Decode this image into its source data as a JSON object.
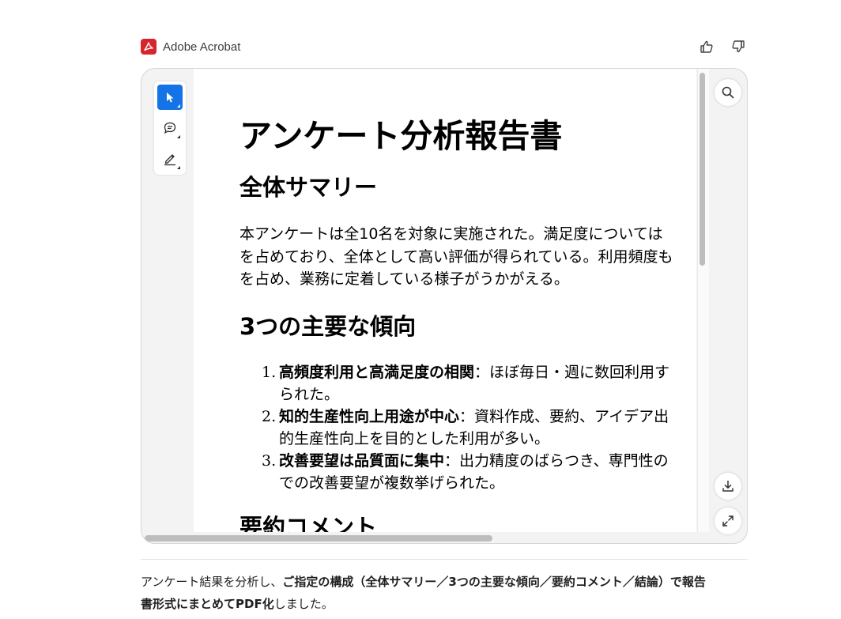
{
  "header": {
    "app_name": "Adobe Acrobat",
    "thumbs_up_icon": "thumbs-up-icon",
    "thumbs_down_icon": "thumbs-down-icon"
  },
  "toolbar": {
    "tools": [
      "select-pointer-icon",
      "comment-icon",
      "draw-pen-icon"
    ]
  },
  "document": {
    "title": "アンケート分析報告書",
    "sections": [
      {
        "heading": "全体サマリー",
        "paragraph_lines": [
          "本アンケートは全10名を対象に実施された。満足度については",
          "を占めており、全体として高い評価が得られている。利用頻度も",
          "を占め、業務に定着している様子がうかがえる。"
        ]
      },
      {
        "heading": "3つの主要な傾向",
        "items": [
          {
            "number": "1.",
            "bold": "高頻度利用と高満足度の相関",
            "rest": "：ほぼ毎日・週に数回利用す",
            "continuation": "られた。"
          },
          {
            "number": "2.",
            "bold": "知的生産性向上用途が中心",
            "rest": "：資料作成、要約、アイデア出",
            "continuation": "的生産性向上を目的とした利用が多い。"
          },
          {
            "number": "3.",
            "bold": "改善要望は品質面に集中",
            "rest": "：出力精度のばらつき、専門性の",
            "continuation": "での改善要望が複数挙げられた。"
          }
        ]
      },
      {
        "heading": "要約コメント"
      }
    ]
  },
  "side_buttons": {
    "search": "search-icon",
    "download": "download-icon",
    "expand": "expand-icon"
  },
  "summary": {
    "line1_plain": "アンケート結果を分析し、",
    "line1_bold": "ご指定の構成（全体サマリー／3つの主要な傾向／要約コメント／結論）で報告",
    "line2_bold": "書形式にまとめてPDF化",
    "line2_plain": "しました。"
  },
  "colors": {
    "brand_red": "#d7262b",
    "accent_blue": "#1473e6"
  }
}
